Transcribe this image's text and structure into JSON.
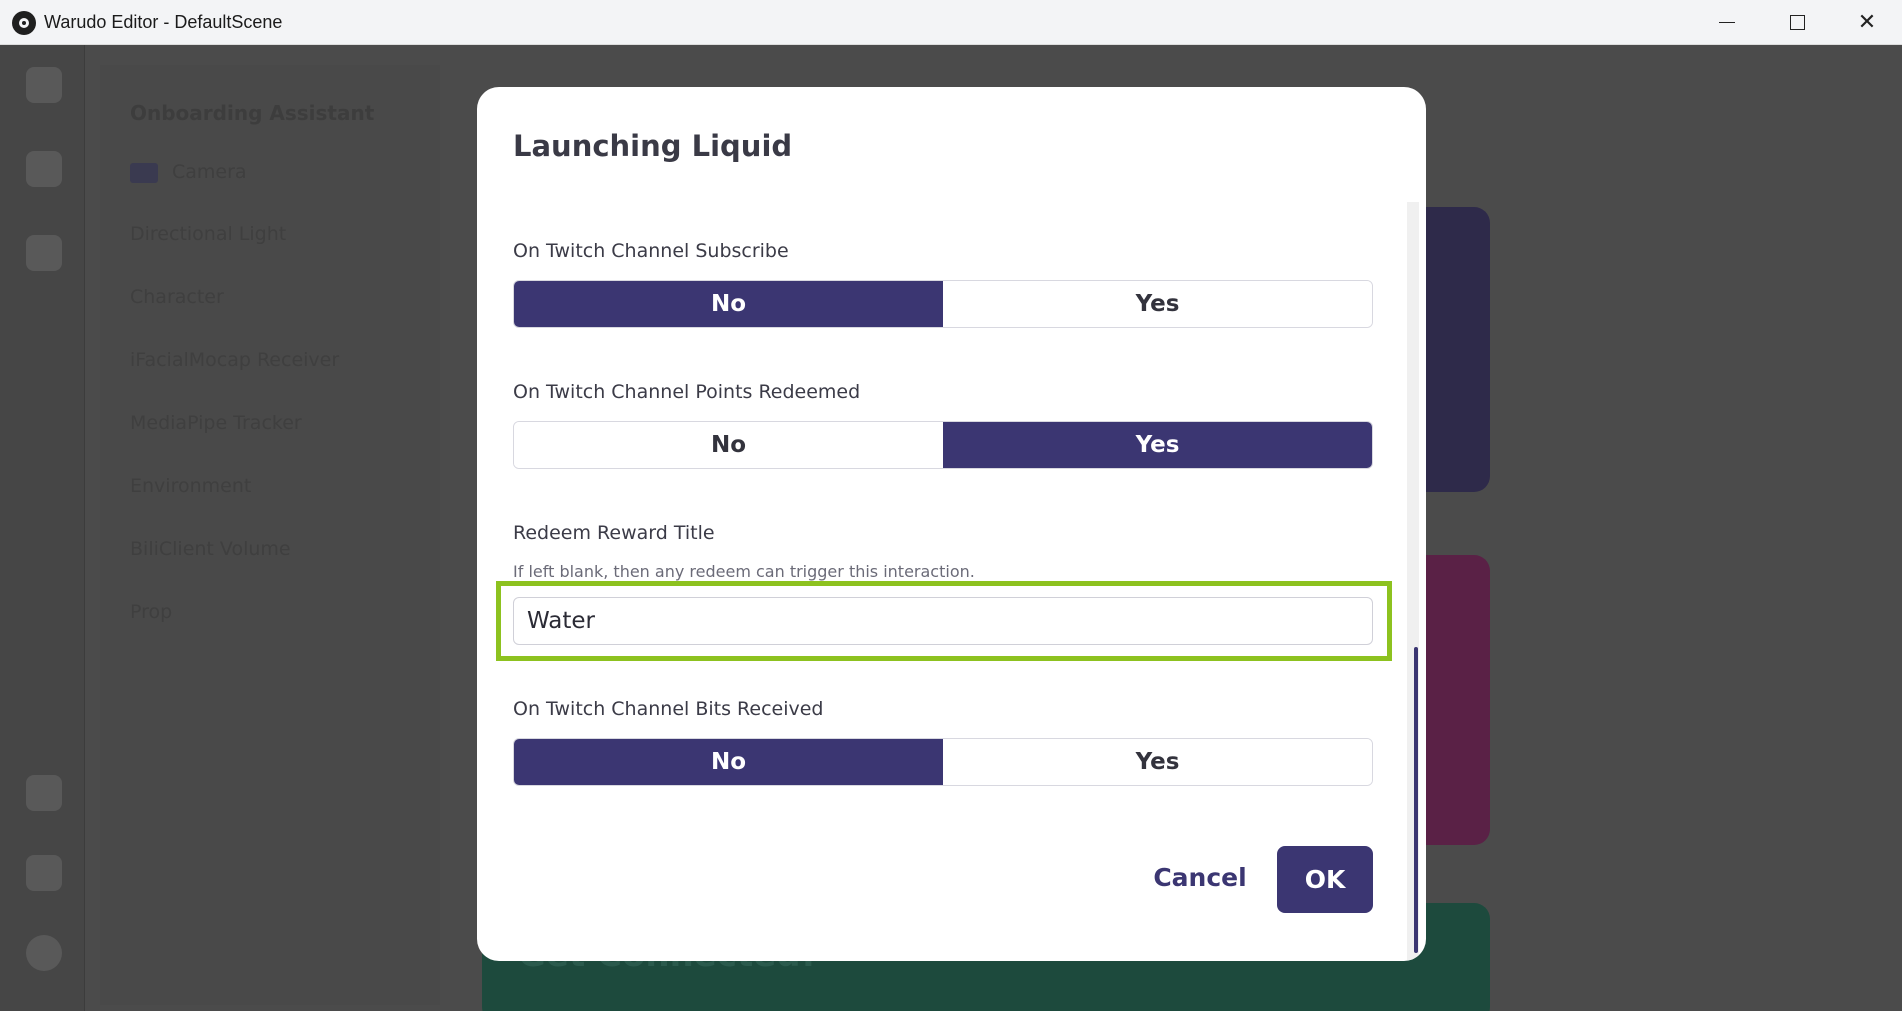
{
  "window": {
    "title": "Warudo Editor - DefaultScene"
  },
  "background": {
    "panel_header": "Onboarding Assistant",
    "panel_items": [
      "Camera",
      "Directional Light",
      "Character",
      "iFacialMocap Receiver",
      "MediaPipe Tracker",
      "Environment",
      "BiliClient Volume",
      "Prop"
    ],
    "card_text": "Get Connected!"
  },
  "dialog": {
    "title": "Launching Liquid",
    "subscribe": {
      "label": "On Twitch Channel Subscribe",
      "options": [
        "No",
        "Yes"
      ],
      "selected": "No"
    },
    "points": {
      "label": "On Twitch Channel Points Redeemed",
      "options": [
        "No",
        "Yes"
      ],
      "selected": "Yes"
    },
    "reward_title": {
      "label": "Redeem Reward Title",
      "hint": "If left blank, then any redeem can trigger this interaction.",
      "value": "Water"
    },
    "bits": {
      "label": "On Twitch Channel Bits Received",
      "options": [
        "No",
        "Yes"
      ],
      "selected": "No"
    },
    "cancel_label": "Cancel",
    "ok_label": "OK"
  },
  "colors": {
    "accent": "#3b3672",
    "highlight": "#8dc21f"
  }
}
